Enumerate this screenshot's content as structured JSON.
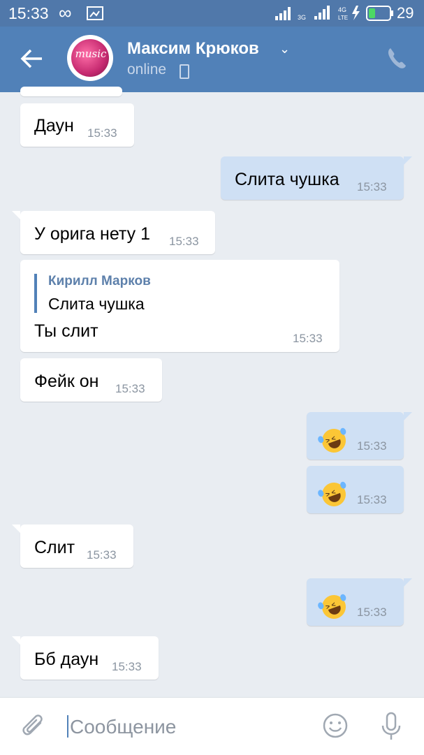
{
  "status": {
    "time": "15:33",
    "battery": "29"
  },
  "header": {
    "name": "Максим Крюков",
    "presence": "online",
    "avatar_text": "music"
  },
  "messages": [
    {
      "text": "Даун",
      "time": "15:33"
    },
    {
      "text": "Слита чушка",
      "time": "15:33"
    },
    {
      "text": "У орига нету 1",
      "time": "15:33"
    },
    {
      "quote_author": "Кирилл Марков",
      "quote_text": "Слита чушка",
      "text": "Ты слит",
      "time": "15:33"
    },
    {
      "text": "Фейк он",
      "time": "15:33"
    },
    {
      "emoji": "rofl",
      "time": "15:33"
    },
    {
      "emoji": "rofl",
      "time": "15:33"
    },
    {
      "text": "Слит",
      "time": "15:33"
    },
    {
      "emoji": "rofl",
      "time": "15:33"
    },
    {
      "text": "Бб даун",
      "time": "15:33"
    }
  ],
  "input": {
    "placeholder": "Сообщение"
  },
  "colors": {
    "header": "#5181b8",
    "outgoing": "#cfe0f4",
    "incoming": "#ffffff",
    "background": "#e9edf2"
  },
  "icons": [
    "back-arrow-icon",
    "phone-icon",
    "attach-icon",
    "emoji-icon",
    "microphone-icon"
  ]
}
